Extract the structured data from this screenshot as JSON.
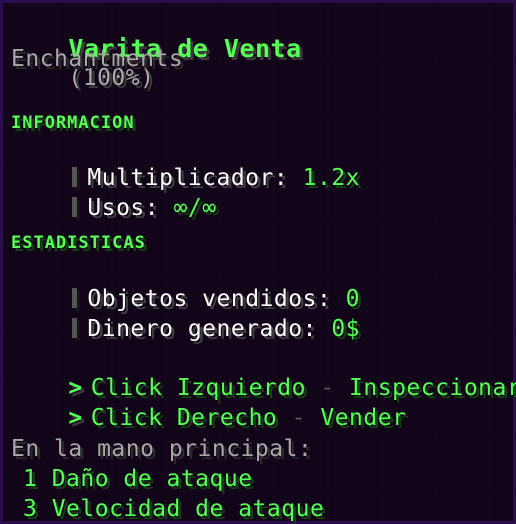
{
  "item": {
    "name": "Varita de Venta",
    "percent": "(100%)",
    "subtitle": "Enchantments"
  },
  "informacion": {
    "header": "INFORMACION",
    "multiplicador_label": "Multiplicador:",
    "multiplicador_value": "1.2x",
    "usos_label": "Usos:",
    "usos_value": "∞/∞"
  },
  "estadisticas": {
    "header": "ESTADISTICAS",
    "objetos_label": "Objetos vendidos:",
    "objetos_value": "0",
    "dinero_label": "Dinero generado:",
    "dinero_value": "0$"
  },
  "actions": {
    "left_action": "Click Izquierdo",
    "left_dash": "-",
    "left_result": "Inspeccionar",
    "right_action": "Click Derecho",
    "right_dash": "-",
    "right_result": "Vender"
  },
  "main_hand": {
    "label": "En la mano principal:",
    "attack_damage": "1 Daño de ataque",
    "attack_speed": "3 Velocidad de ataque"
  },
  "colors": {
    "accent": "#55ff55",
    "label": "#ffffff",
    "muted": "#a8a8a8",
    "separator": "#555555",
    "border": "#2a0d4f",
    "background": "#120518"
  }
}
